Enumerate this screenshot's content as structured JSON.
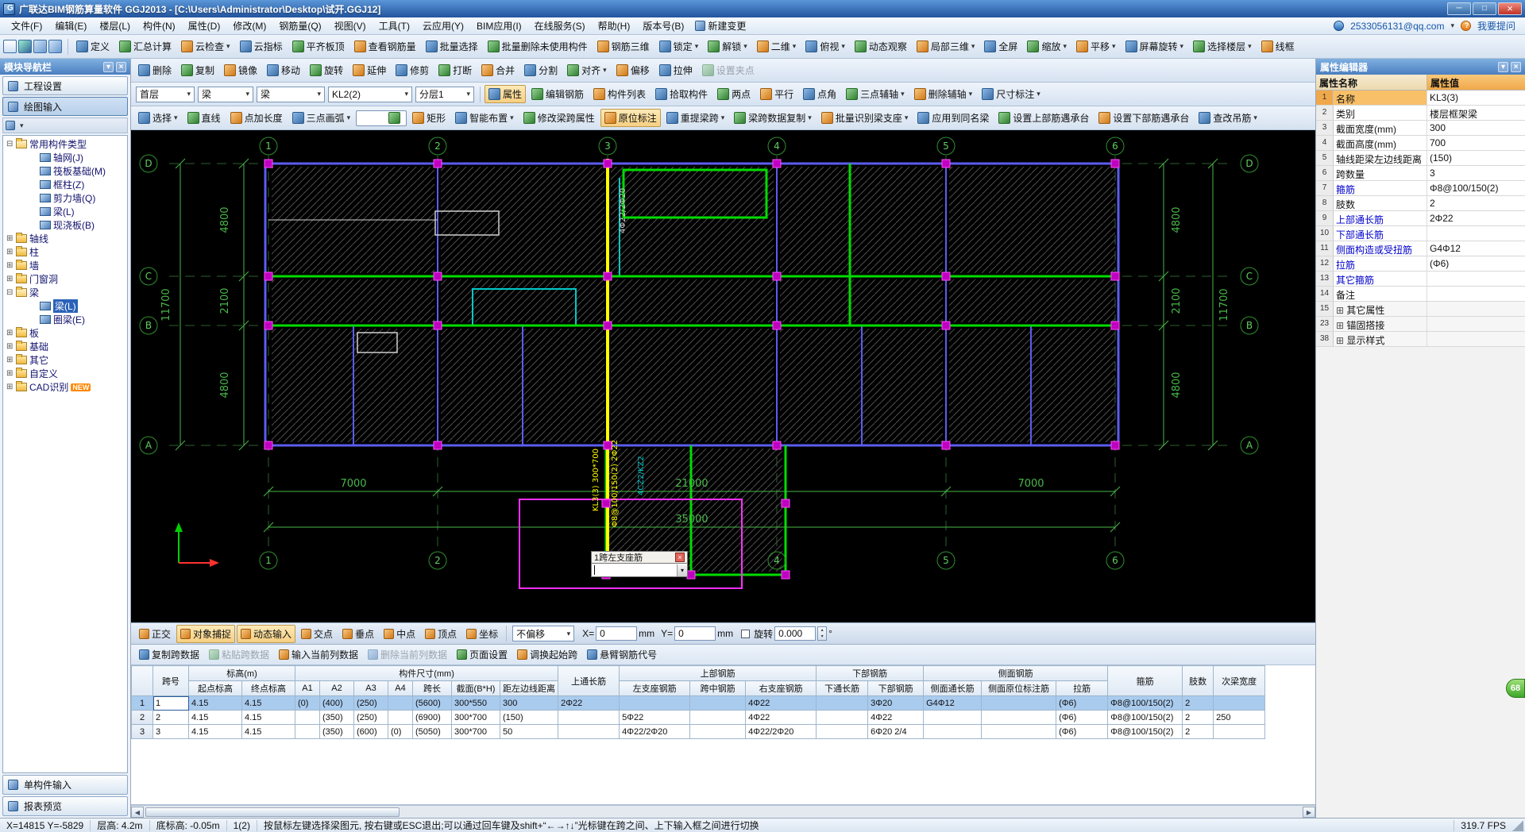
{
  "window": {
    "title": "广联达BIM钢筋算量软件 GGJ2013 - [C:\\Users\\Administrator\\Desktop\\试开.GGJ12]"
  },
  "menu": {
    "items": [
      "文件(F)",
      "编辑(E)",
      "楼层(L)",
      "构件(N)",
      "属性(D)",
      "修改(M)",
      "钢筋量(Q)",
      "视图(V)",
      "工具(T)",
      "云应用(Y)",
      "BIM应用(I)",
      "在线服务(S)",
      "帮助(H)",
      "版本号(B)"
    ],
    "new_change": "新建变更",
    "account": "2533056131@qq.com",
    "ask": "我要提问"
  },
  "toolbar_file": {
    "icons": [
      "new-file-icon",
      "save-icon",
      "undo-icon",
      "redo-icon"
    ]
  },
  "toolbar_top": {
    "items": [
      {
        "label": "定义"
      },
      {
        "label": "汇总计算"
      },
      {
        "label": "云检查",
        "arrow": true
      },
      {
        "label": "云指标"
      },
      {
        "label": "平齐板顶"
      },
      {
        "label": "查看钢筋量"
      },
      {
        "label": "批量选择"
      },
      {
        "label": "批量删除未使用构件"
      },
      {
        "label": "钢筋三维"
      },
      {
        "label": "锁定",
        "arrow": true
      },
      {
        "label": "解锁",
        "arrow": true
      },
      {
        "label": "二维",
        "arrow": true
      },
      {
        "label": "俯视",
        "arrow": true
      },
      {
        "label": "动态观察"
      },
      {
        "label": "局部三维",
        "arrow": true
      },
      {
        "label": "全屏"
      },
      {
        "label": "缩放",
        "arrow": true
      },
      {
        "label": "平移",
        "arrow": true
      },
      {
        "label": "屏幕旋转",
        "arrow": true
      },
      {
        "label": "选择楼层",
        "arrow": true
      },
      {
        "label": "线框"
      }
    ]
  },
  "toolbar_edit": {
    "items": [
      {
        "label": "删除"
      },
      {
        "label": "复制"
      },
      {
        "label": "镜像"
      },
      {
        "label": "移动"
      },
      {
        "label": "旋转"
      },
      {
        "label": "延伸"
      },
      {
        "label": "修剪"
      },
      {
        "label": "打断"
      },
      {
        "label": "合并"
      },
      {
        "label": "分割"
      },
      {
        "label": "对齐",
        "arrow": true
      },
      {
        "label": "偏移"
      },
      {
        "label": "拉伸"
      },
      {
        "label": "设置夹点",
        "disabled": true
      }
    ]
  },
  "toolbar_context": {
    "combos": [
      {
        "value": "首层"
      },
      {
        "value": "梁"
      },
      {
        "value": "梁"
      },
      {
        "value": "KL2(2)"
      },
      {
        "value": "分层1"
      }
    ],
    "buttons": [
      {
        "label": "属性",
        "pressed": true
      },
      {
        "label": "编辑钢筋"
      },
      {
        "label": "构件列表"
      },
      {
        "label": "拾取构件"
      },
      {
        "label": "两点"
      },
      {
        "label": "平行"
      },
      {
        "label": "点角"
      },
      {
        "label": "三点辅轴",
        "arrow": true
      },
      {
        "label": "删除辅轴",
        "arrow": true
      },
      {
        "label": "尺寸标注",
        "arrow": true
      }
    ]
  },
  "toolbar_draw": {
    "items": [
      {
        "label": "选择",
        "arrow": true
      },
      {
        "label": "直线"
      },
      {
        "label": "点加长度"
      },
      {
        "label": "三点画弧",
        "arrow": true
      },
      {
        "label": "",
        "combo": true
      },
      {
        "label": "矩形"
      },
      {
        "label": "智能布置",
        "arrow": true
      },
      {
        "label": "修改梁跨属性"
      },
      {
        "label": "原位标注",
        "pressed": true
      },
      {
        "label": "重提梁跨",
        "arrow": true
      },
      {
        "label": "梁跨数据复制",
        "arrow": true
      },
      {
        "label": "批量识别梁支座",
        "arrow": true
      },
      {
        "label": "应用到同名梁"
      },
      {
        "label": "设置上部筋遇承台"
      },
      {
        "label": "设置下部筋遇承台"
      },
      {
        "label": "查改吊筋",
        "arrow": true
      }
    ]
  },
  "snapbar": {
    "toggles": [
      {
        "label": "正交"
      },
      {
        "label": "对象捕捉",
        "pressed": true
      },
      {
        "label": "动态输入",
        "pressed": true
      },
      {
        "label": "交点"
      },
      {
        "label": "垂点"
      },
      {
        "label": "中点"
      },
      {
        "label": "顶点"
      },
      {
        "label": "坐标"
      }
    ],
    "offset": "不偏移",
    "x_label": "X=",
    "x_value": "0",
    "x_unit": "mm",
    "y_label": "Y=",
    "y_value": "0",
    "y_unit": "mm",
    "rotate_label": "旋转",
    "rotate_value": "0.000",
    "degree": "°"
  },
  "spanbar": {
    "items": [
      {
        "label": "复制跨数据"
      },
      {
        "label": "粘贴跨数据",
        "disabled": true
      },
      {
        "label": "输入当前列数据"
      },
      {
        "label": "删除当前列数据",
        "disabled": true
      },
      {
        "label": "页面设置"
      },
      {
        "label": "调换起始跨"
      },
      {
        "label": "悬臂钢筋代号"
      }
    ]
  },
  "nav": {
    "title": "模块导航栏",
    "buttons": [
      "工程设置",
      "绘图输入"
    ],
    "tree": [
      {
        "label": "常用构件类型",
        "folder": true,
        "open": true
      },
      {
        "label": "轴网(J)",
        "child": true,
        "icon": "axis-grid-icon"
      },
      {
        "label": "筏板基础(M)",
        "child": true,
        "icon": "raft-foundation-icon"
      },
      {
        "label": "框柱(Z)",
        "child": true,
        "icon": "frame-column-icon"
      },
      {
        "label": "剪力墙(Q)",
        "child": true,
        "icon": "shear-wall-icon"
      },
      {
        "label": "梁(L)",
        "child": true,
        "icon": "beam-icon"
      },
      {
        "label": "现浇板(B)",
        "child": true,
        "icon": "slab-icon"
      },
      {
        "label": "轴线",
        "folder": true
      },
      {
        "label": "柱",
        "folder": true
      },
      {
        "label": "墙",
        "folder": true
      },
      {
        "label": "门窗洞",
        "folder": true
      },
      {
        "label": "梁",
        "folder": true,
        "open": true
      },
      {
        "label": "梁(L)",
        "child": true,
        "selected": true,
        "icon": "beam-icon"
      },
      {
        "label": "圈梁(E)",
        "child": true,
        "icon": "ring-beam-icon"
      },
      {
        "label": "板",
        "folder": true
      },
      {
        "label": "基础",
        "folder": true
      },
      {
        "label": "其它",
        "folder": true
      },
      {
        "label": "自定义",
        "folder": true
      },
      {
        "label": "CAD识别",
        "folder": true,
        "badge": "NEW"
      }
    ],
    "bottom_buttons": [
      "单构件输入",
      "报表预览"
    ]
  },
  "props": {
    "title": "属性编辑器",
    "header": {
      "name": "属性名称",
      "value": "属性值"
    },
    "rows": [
      {
        "num": "1",
        "name": "名称",
        "value": "KL3(3)",
        "selected": true
      },
      {
        "num": "2",
        "name": "类别",
        "value": "楼层框架梁"
      },
      {
        "num": "3",
        "name": "截面宽度(mm)",
        "value": "300"
      },
      {
        "num": "4",
        "name": "截面高度(mm)",
        "value": "700"
      },
      {
        "num": "5",
        "name": "轴线距梁左边线距离",
        "value": "(150)"
      },
      {
        "num": "6",
        "name": "跨数量",
        "value": "3"
      },
      {
        "num": "7",
        "name": "箍筋",
        "value": "Φ8@100/150(2)",
        "blue": true
      },
      {
        "num": "8",
        "name": "肢数",
        "value": "2"
      },
      {
        "num": "9",
        "name": "上部通长筋",
        "value": "2Φ22",
        "blue": true
      },
      {
        "num": "10",
        "name": "下部通长筋",
        "value": "",
        "blue": true
      },
      {
        "num": "11",
        "name": "侧面构造或受扭筋",
        "value": "G4Φ12",
        "blue": true
      },
      {
        "num": "12",
        "name": "拉筋",
        "value": "(Φ6)",
        "blue": true
      },
      {
        "num": "13",
        "name": "其它箍筋",
        "value": "",
        "blue": true
      },
      {
        "num": "14",
        "name": "备注",
        "value": ""
      },
      {
        "num": "15",
        "name": "其它属性",
        "value": "",
        "group": true
      },
      {
        "num": "23",
        "name": "锚固搭接",
        "value": "",
        "group": true
      },
      {
        "num": "38",
        "name": "显示样式",
        "value": "",
        "group": true
      }
    ]
  },
  "table": {
    "h_top": [
      "跨号",
      "标高(m)",
      "构件尺寸(mm)",
      "上通长筋",
      "上部钢筋",
      "下部钢筋",
      "侧面钢筋",
      "箍筋",
      "肢数",
      "次梁宽度"
    ],
    "h_sub": [
      "起点标高",
      "终点标高",
      "A1",
      "A2",
      "A3",
      "A4",
      "跨长",
      "截面(B*H)",
      "距左边线距离",
      "左支座钢筋",
      "跨中钢筋",
      "右支座钢筋",
      "下通长筋",
      "下部钢筋",
      "侧面通长筋",
      "侧面原位标注筋",
      "拉筋"
    ],
    "rows": [
      {
        "no": "1",
        "start": "4.15",
        "end": "4.15",
        "a1": "(0)",
        "a2": "(400)",
        "a3": "(250)",
        "a4": "",
        "len": "(5600)",
        "section": "300*550",
        "dist": "300",
        "top_through": "2Φ22",
        "left_sup": "",
        "mid": "",
        "right_sup": "4Φ22",
        "bot_through": "",
        "bot": "3Φ20",
        "side_through": "G4Φ12",
        "side_insitu": "",
        "tie": "(Φ6)",
        "stirrup": "Φ8@100/150(2)",
        "legs": "2",
        "sub_width": "",
        "selected": true
      },
      {
        "no": "2",
        "start": "4.15",
        "end": "4.15",
        "a1": "",
        "a2": "(350)",
        "a3": "(250)",
        "a4": "",
        "len": "(6900)",
        "section": "300*700",
        "dist": "(150)",
        "top_through": "",
        "left_sup": "5Φ22",
        "mid": "",
        "right_sup": "4Φ22",
        "bot_through": "",
        "bot": "4Φ22",
        "side_through": "",
        "side_insitu": "",
        "tie": "(Φ6)",
        "stirrup": "Φ8@100/150(2)",
        "legs": "2",
        "sub_width": "250"
      },
      {
        "no": "3",
        "start": "4.15",
        "end": "4.15",
        "a1": "",
        "a2": "(350)",
        "a3": "(600)",
        "a4": "(0)",
        "len": "(5050)",
        "section": "300*700",
        "dist": "50",
        "top_through": "",
        "left_sup": "4Φ22/2Φ20",
        "mid": "",
        "right_sup": "4Φ22/2Φ20",
        "bot_through": "",
        "bot": "6Φ20 2/4",
        "side_through": "",
        "side_insitu": "",
        "tie": "(Φ6)",
        "stirrup": "Φ8@100/150(2)",
        "legs": "2",
        "sub_width": ""
      }
    ]
  },
  "canvas": {
    "grid_cols": [
      "1",
      "2",
      "3",
      "4",
      "5",
      "6"
    ],
    "grid_rows": [
      "D",
      "C",
      "B",
      "A"
    ],
    "dims_left": [
      "4800",
      "2100",
      "4800"
    ],
    "dim_left_total": "11700",
    "dims_right": [
      "4800",
      "2100",
      "4800"
    ],
    "dim_right_total": "11700",
    "dims_bottom": [
      "7000",
      "21000",
      "7000"
    ],
    "dim_bottom_total": "35000",
    "beam_label": "KL3(3) 300*700",
    "beam_label2": "Φ8@100/150(2) 2Φ22",
    "label_top": "4Φ22/2Φ20",
    "label_col": "4CZ2/KZ2",
    "popup": {
      "title": "1跨左支座筋",
      "value": ""
    }
  },
  "status": {
    "coords": "X=14815 Y=-5829",
    "floor_height": "层高: 4.2m",
    "bottom_elev": "底标高: -0.05m",
    "span": "1(2)",
    "hint": "按鼠标左键选择梁图元, 按右键或ESC退出;可以通过回车键及shift+“←→↑↓”光标键在跨之间、上下输入框之间进行切换",
    "fps": "319.7 FPS"
  },
  "misc": {
    "badge": "68"
  }
}
